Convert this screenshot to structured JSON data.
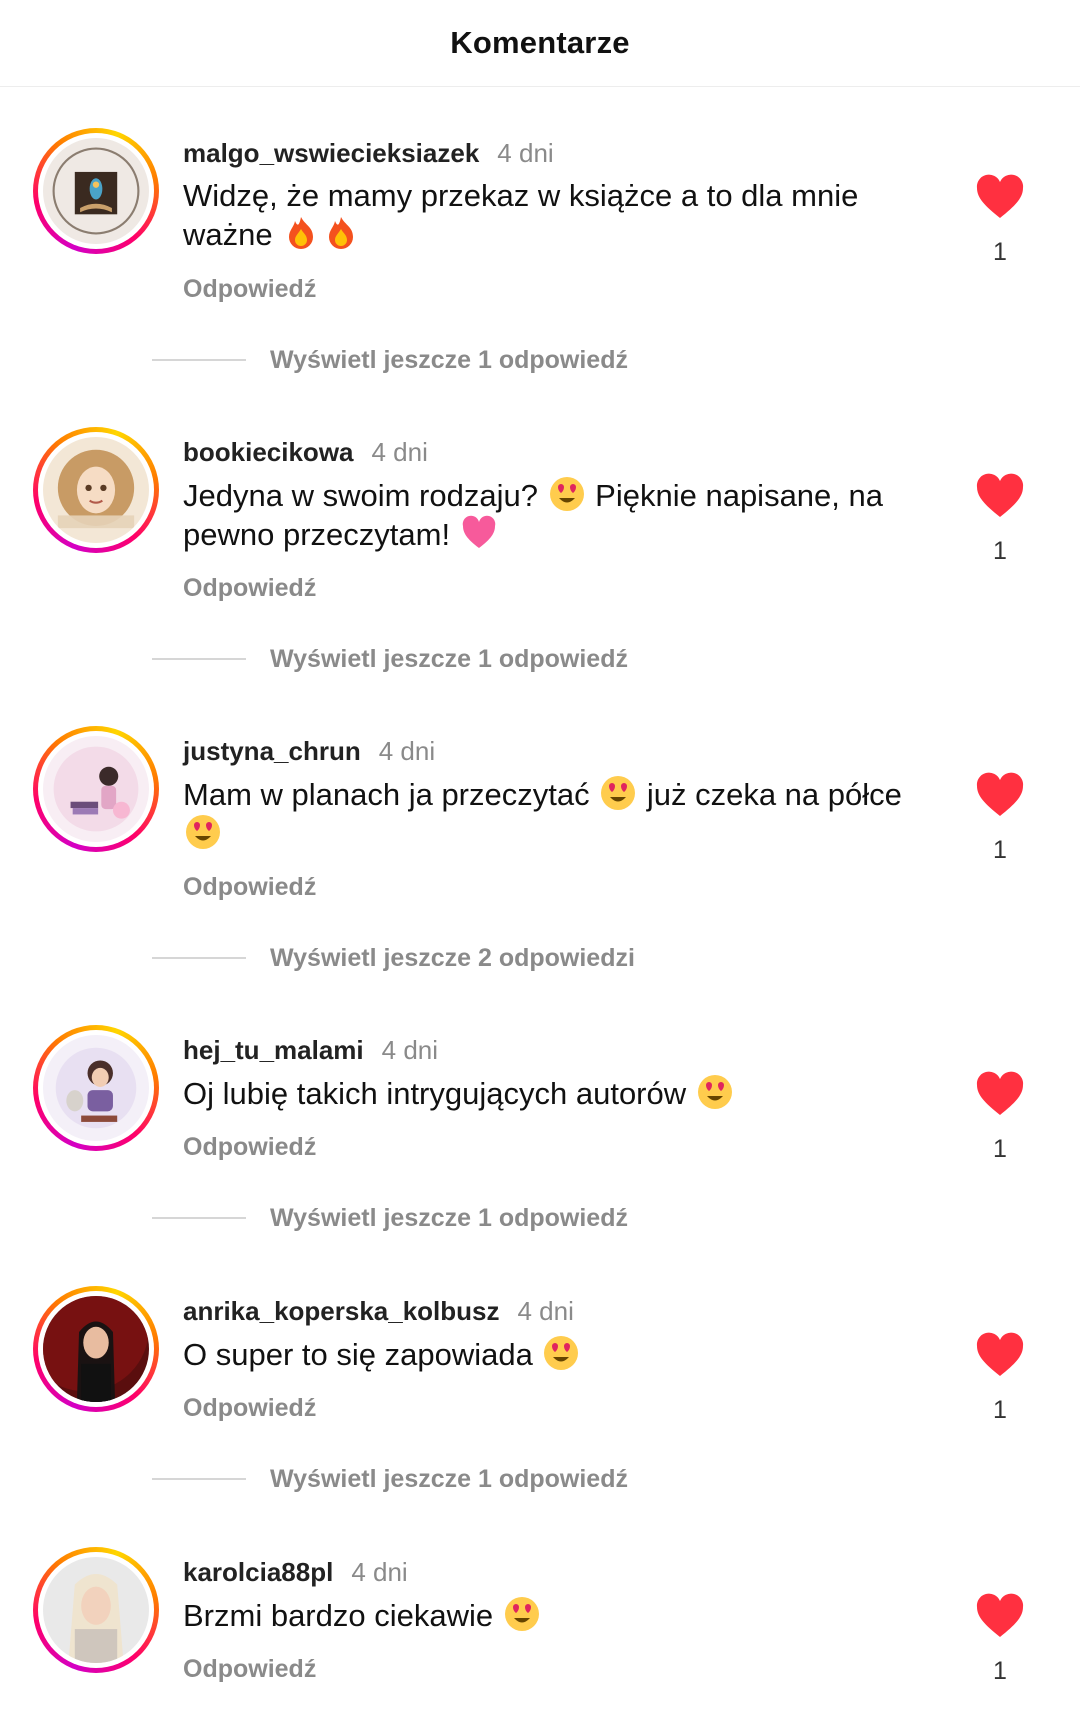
{
  "header": {
    "title": "Komentarze"
  },
  "colors": {
    "like": "#ff3040",
    "muted": "#8a8a8a"
  },
  "comments": [
    {
      "username": "malgo_wswiecieksiazek",
      "time": "4 dni",
      "parts": [
        "Widzę, że mamy przekaz w książce a to dla mnie ważne ",
        "",
        ""
      ],
      "emojis": [
        "fire",
        "fire"
      ],
      "reply_label": "Odpowiedź",
      "likes": "1",
      "more_replies": "Wyświetl jeszcze 1 odpowiedź"
    },
    {
      "username": "bookiecikowa",
      "time": "4 dni",
      "parts": [
        "Jedyna w swoim rodzaju? ",
        " Pięknie napisane, na pewno przeczytam! ",
        ""
      ],
      "emojis": [
        "heart-eyes",
        "pink-heart"
      ],
      "reply_label": "Odpowiedź",
      "likes": "1",
      "more_replies": "Wyświetl jeszcze 1 odpowiedź"
    },
    {
      "username": "justyna_chrun",
      "time": "4 dni",
      "parts": [
        "Mam w planach ja przeczytać ",
        " już czeka na półce ",
        ""
      ],
      "emojis": [
        "heart-eyes",
        "heart-eyes"
      ],
      "reply_label": "Odpowiedź",
      "likes": "1",
      "more_replies": "Wyświetl jeszcze 2 odpowiedzi"
    },
    {
      "username": "hej_tu_malami",
      "time": "4 dni",
      "parts": [
        "Oj lubię takich intrygujących autorów ",
        "",
        ""
      ],
      "emojis": [
        "heart-eyes"
      ],
      "reply_label": "Odpowiedź",
      "likes": "1",
      "more_replies": "Wyświetl jeszcze 1 odpowiedź"
    },
    {
      "username": "anrika_koperska_kolbusz",
      "time": "4 dni",
      "parts": [
        "O super to się zapowiada ",
        "",
        ""
      ],
      "emojis": [
        "heart-eyes"
      ],
      "reply_label": "Odpowiedź",
      "likes": "1",
      "more_replies": "Wyświetl jeszcze 1 odpowiedź"
    },
    {
      "username": "karolcia88pl",
      "time": "4 dni",
      "parts": [
        "Brzmi bardzo ciekawie ",
        "",
        ""
      ],
      "emojis": [
        "heart-eyes"
      ],
      "reply_label": "Odpowiedź",
      "likes": "1",
      "more_replies": ""
    }
  ]
}
